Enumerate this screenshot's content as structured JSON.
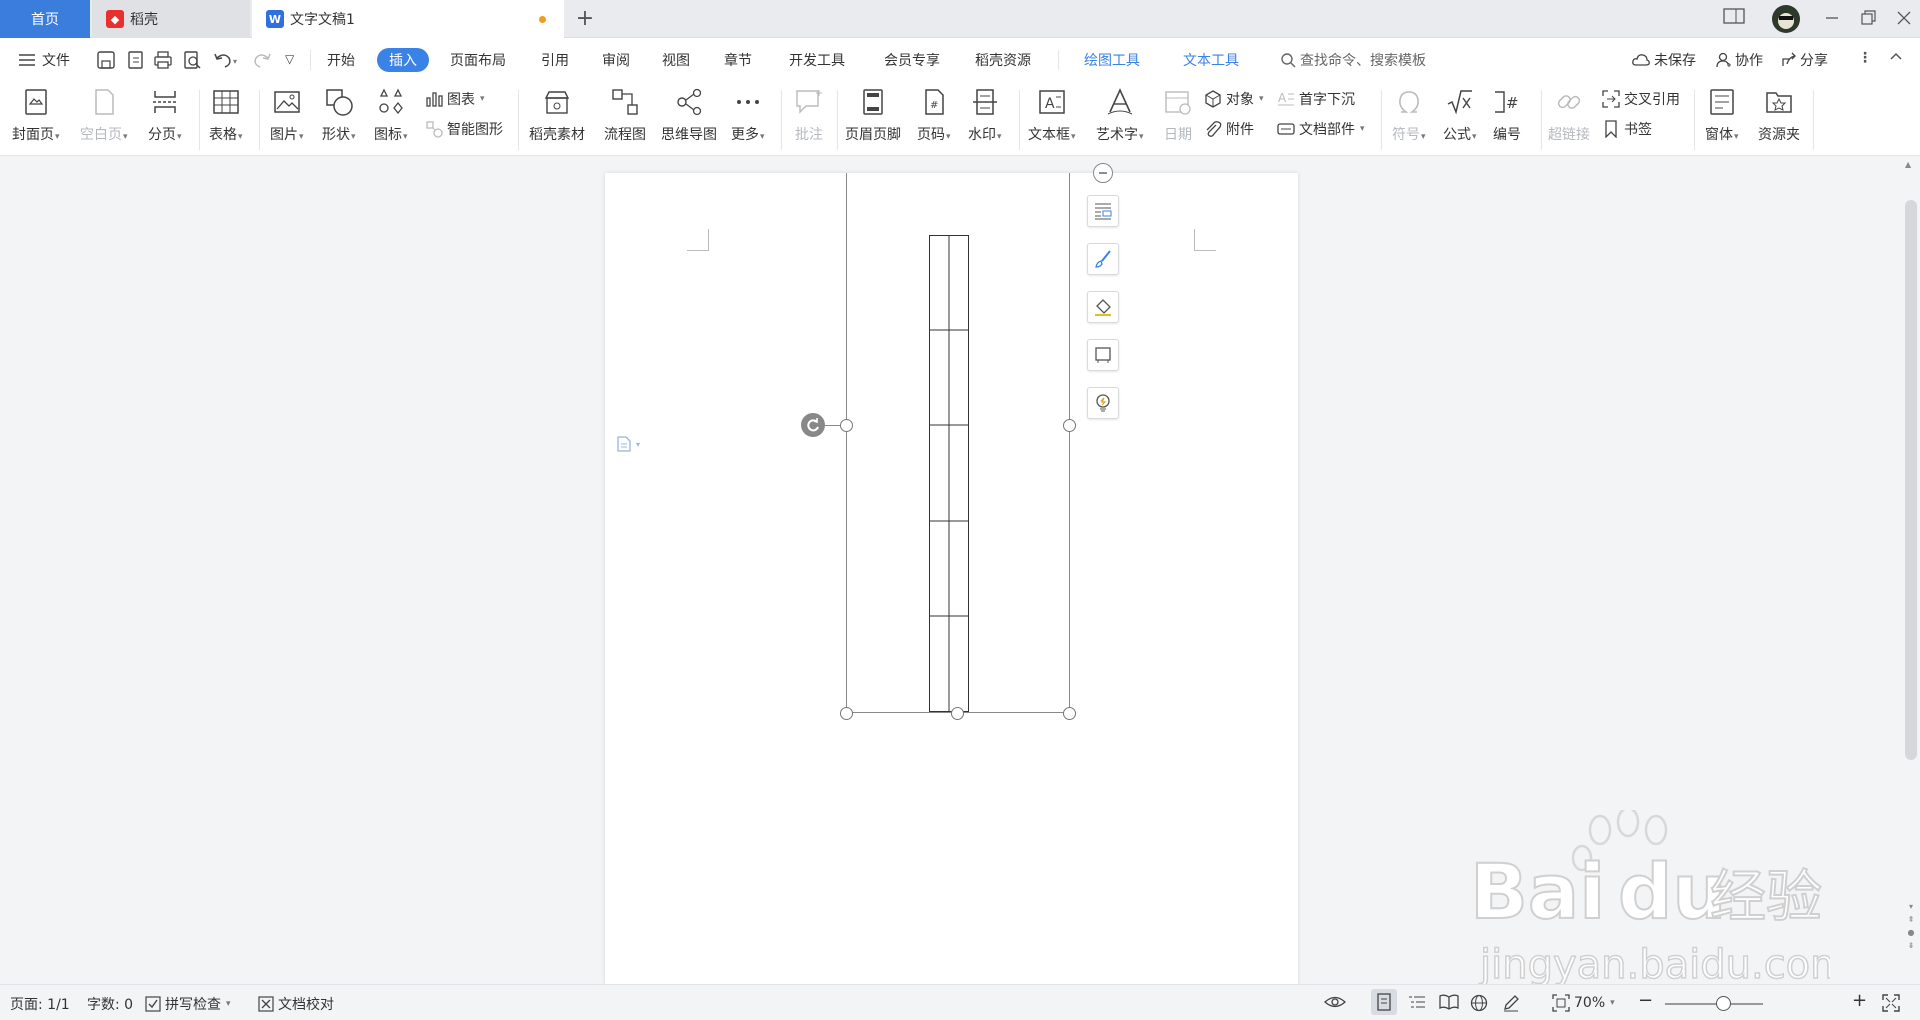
{
  "tabs": {
    "home": "首页",
    "daoke": "稻壳",
    "doc": "文字文稿1",
    "add": "+"
  },
  "menubar": {
    "file": "文件",
    "items": [
      "开始",
      "插入",
      "页面布局",
      "引用",
      "审阅",
      "视图",
      "章节",
      "开发工具",
      "会员专享",
      "稻壳资源"
    ],
    "context_tabs": [
      "绘图工具",
      "文本工具"
    ],
    "search_placeholder": "查找命令、搜索模板",
    "unsaved": "未保存",
    "collab": "协作",
    "share": "分享"
  },
  "ribbon": {
    "cover": "封面页",
    "blank": "空白页",
    "pagebreak": "分页",
    "table": "表格",
    "picture": "图片",
    "shape": "形状",
    "icon": "图标",
    "chart": "图表",
    "smart": "智能图形",
    "daoke_material": "稻壳素材",
    "flowchart": "流程图",
    "mindmap": "思维导图",
    "more": "更多",
    "comment": "批注",
    "header_footer": "页眉页脚",
    "page_number": "页码",
    "watermark": "水印",
    "textbox": "文本框",
    "wordart": "艺术字",
    "date": "日期",
    "object": "对象",
    "attachment": "附件",
    "dropcap": "首字下沉",
    "docparts": "文档部件",
    "symbol": "符号",
    "formula": "公式",
    "numbering": "编号",
    "hyperlink": "超链接",
    "crossref": "交叉引用",
    "bookmark": "书签",
    "form": "窗体",
    "resource": "资源夹"
  },
  "status": {
    "page": "页面: 1/1",
    "words": "字数: 0",
    "spell": "拼写检查",
    "proof": "文档校对",
    "zoom": "70%"
  },
  "watermark": {
    "brand_a": "Bai",
    "brand_b": "du",
    "brand_cn": "经验",
    "url": "jingyan.baidu.com"
  },
  "colors": {
    "accent": "#3b82e6",
    "tab_home": "#3b7ddd",
    "modified_dot": "#f29b1d"
  }
}
